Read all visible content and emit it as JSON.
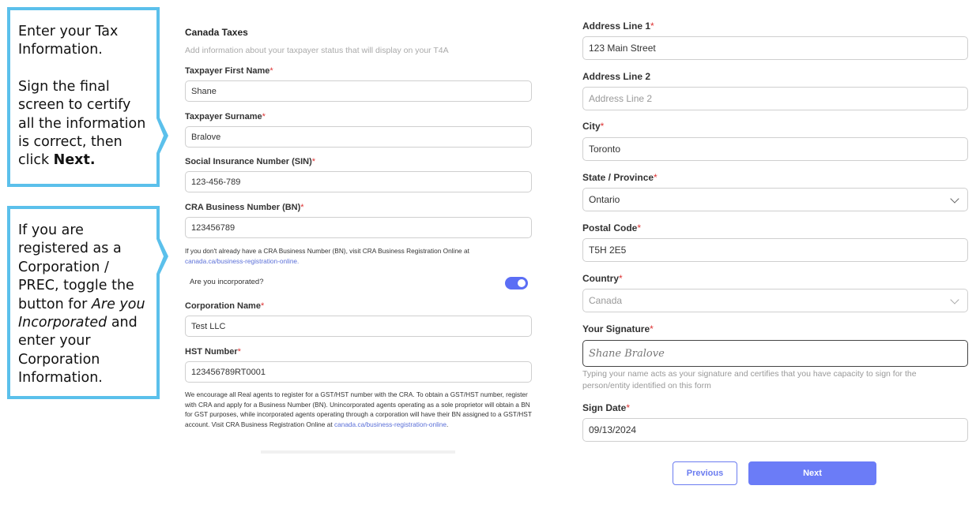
{
  "callouts": {
    "first": {
      "line1": "Enter your Tax Information.",
      "line2_pre": "Sign the final screen to certify all the information is correct, then click ",
      "line2_bold": "Next."
    },
    "second": {
      "pre": "If you are registered as a Corporation / PREC, toggle the button for ",
      "italic": "Are you Incorporated",
      "post": " and enter your Corporation Information."
    }
  },
  "left": {
    "title": "Canada Taxes",
    "subtitle": "Add information about your taxpayer status that will display on your T4A",
    "first_name": {
      "label": "Taxpayer First Name",
      "value": "Shane"
    },
    "surname": {
      "label": "Taxpayer Surname",
      "value": "Bralove"
    },
    "sin": {
      "label": "Social Insurance Number (SIN)",
      "value": "123-456-789"
    },
    "bn": {
      "label": "CRA Business Number (BN)",
      "value": "123456789"
    },
    "bn_note": "If you don't already have a CRA Business Number (BN), visit CRA Business Registration Online at",
    "bn_link": "canada.ca/business-registration-online.",
    "incorporated_label": "Are you incorporated?",
    "incorporated": true,
    "corp_name": {
      "label": "Corporation Name",
      "value": "Test LLC"
    },
    "hst": {
      "label": "HST Number",
      "value": "123456789RT0001"
    },
    "hst_note": "We encourage all Real agents to register for a GST/HST number with the CRA. To obtain a GST/HST number, register with CRA and apply for a Business Number (BN). Unincorporated agents operating as a sole proprietor will obtain a BN for GST purposes, while incorporated agents operating through a corporation will have their BN assigned to a GST/HST account. Visit CRA Business Registration Online at ",
    "hst_link": "canada.ca/business-registration-online",
    "hst_end": "."
  },
  "right": {
    "address1": {
      "label": "Address Line 1",
      "value": "123 Main Street"
    },
    "address2": {
      "label": "Address Line 2",
      "placeholder": "Address Line 2"
    },
    "city": {
      "label": "City",
      "value": "Toronto"
    },
    "province": {
      "label": "State / Province",
      "value": "Ontario"
    },
    "postal": {
      "label": "Postal Code",
      "value": "T5H 2E5"
    },
    "country": {
      "label": "Country",
      "value": "Canada"
    },
    "signature": {
      "label": "Your Signature",
      "value": "Shane Bralove"
    },
    "signature_help": "Typing your name acts as your signature and certifies that you have capacity to sign for the person/entity identified on this form",
    "sign_date": {
      "label": "Sign Date",
      "value": "09/13/2024"
    },
    "required_mark": "*"
  },
  "buttons": {
    "previous": "Previous",
    "next": "Next"
  },
  "colors": {
    "accent": "#6b7cf7",
    "callout_border": "#5bc0eb",
    "required": "#d33333"
  }
}
